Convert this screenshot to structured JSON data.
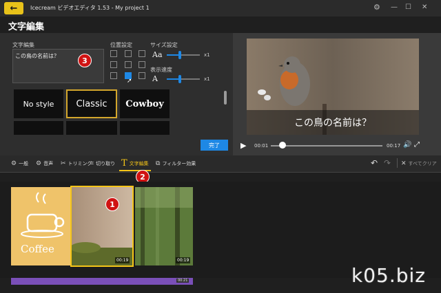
{
  "window": {
    "app_title": "Icecream ビデオエディタ 1.53  -  My project 1",
    "minimize_glyph": "—",
    "maximize_glyph": "☐",
    "close_glyph": "✕"
  },
  "header": {
    "title": "文字編集",
    "back_icon": "arrow-left-icon"
  },
  "editor": {
    "text_label": "文字編集",
    "text_value": "この鳥の名前は？",
    "position_label": "位置設定",
    "position_grid_selected": "row 3, column 2",
    "size_label": "サイズ設定",
    "size_glyph": "Aa",
    "size_value_label": "x1",
    "speed_label": "表示速度",
    "speed_glyph": "A",
    "speed_value_label": "x1",
    "styles": [
      "No style",
      "Classic",
      "Cowboy"
    ],
    "selected_style": "Classic",
    "done_label": "完了"
  },
  "preview": {
    "subtitle": "この鳥の名前は？",
    "current_time": "00:01",
    "end_time": "00:17"
  },
  "toolbar": {
    "items": [
      {
        "label": "一般",
        "icon": "gear-icon"
      },
      {
        "label": "音声",
        "icon": "gear-icon"
      },
      {
        "label": "トリミング",
        "icon": "scissors-icon"
      },
      {
        "label": "切り取り",
        "icon": "crop-icon"
      },
      {
        "label": "文字編集",
        "icon": "text-icon"
      },
      {
        "label": "フィルター効果",
        "icon": "filter-icon"
      }
    ],
    "active_item": "文字編集",
    "undo_icon": "undo-icon",
    "redo_icon": "redo-icon",
    "clear_all_label": "すべてクリア"
  },
  "timeline": {
    "clips": [
      {
        "name": "coffee",
        "time": ""
      },
      {
        "name": "bird",
        "time": "00:19"
      },
      {
        "name": "forest",
        "time": "00:19"
      }
    ],
    "audio_end": "00:21"
  },
  "annotations": [
    "1",
    "2",
    "3"
  ],
  "watermark": "k05.biz",
  "colors": {
    "accent": "#1e88e5",
    "highlight": "#f5c518",
    "badge": "#d01313",
    "audio": "#7a4fb8"
  }
}
